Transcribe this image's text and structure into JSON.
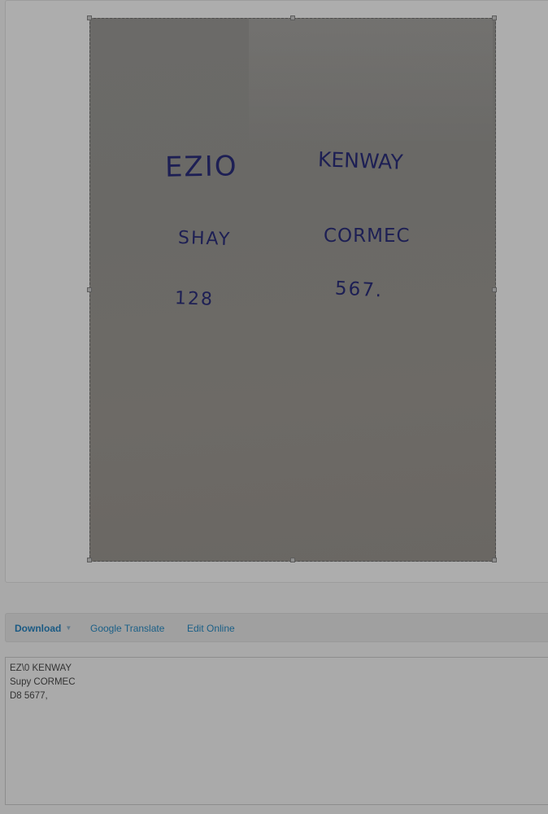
{
  "image": {
    "handwriting": {
      "row1_left": "EZIO",
      "row1_right": "KENWAY",
      "row2_left": "SHAY",
      "row2_right": "CORMEC",
      "row3_left": "128",
      "row3_right": "567."
    }
  },
  "toolbar": {
    "download_label": "Download",
    "translate_label": "Google Translate",
    "edit_label": "Edit Online"
  },
  "result": {
    "lines": [
      "EZ\\0 KENWAY",
      "Supy CORMEC",
      "D8 5677,"
    ]
  },
  "colors": {
    "link": "#1a5f87",
    "ink": "#1d1f54"
  }
}
